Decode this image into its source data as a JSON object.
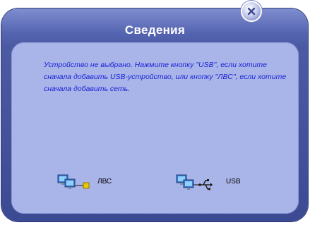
{
  "dialog": {
    "title": "Сведения",
    "message": "Устройство не выбрано. Нажмите кнопку \"USB\", если хотите сначала добавить USB-устройство, или кнопку \"ЛВС\", если хотите сначала добавить сеть.",
    "close_icon": "close-icon"
  },
  "actions": {
    "lan": {
      "label": "ЛВС",
      "icon": "network-computers-icon"
    },
    "usb": {
      "label": "USB",
      "icon": "usb-computers-icon"
    }
  },
  "colors": {
    "frame": "#4a58a2",
    "content": "#a9b5e9",
    "message_text": "#1b22d6",
    "title_text": "#ffffff"
  }
}
